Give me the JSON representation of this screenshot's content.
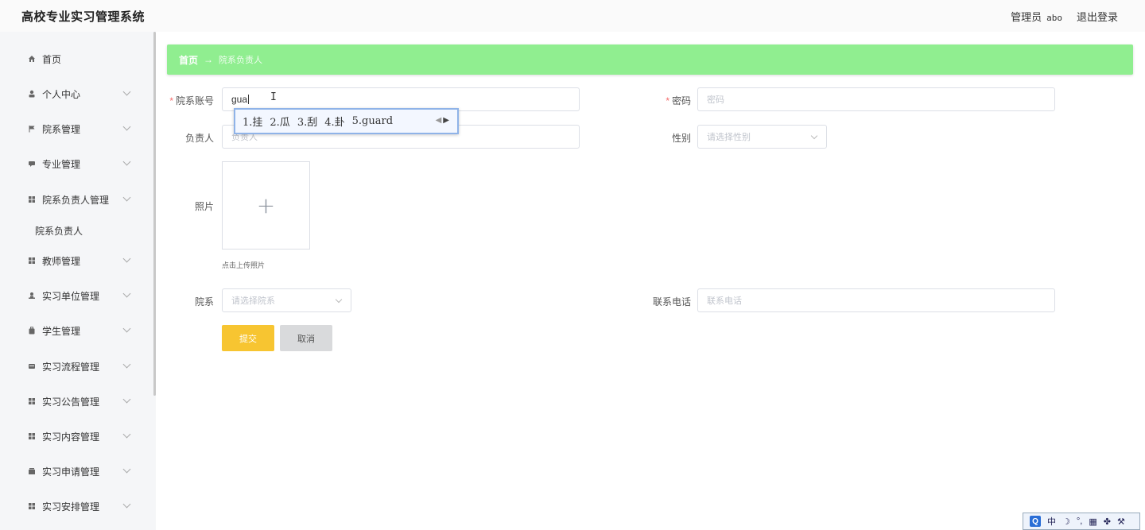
{
  "header": {
    "app_title": "高校专业实习管理系统",
    "role": "管理员",
    "username": "abo",
    "logout": "退出登录"
  },
  "sidebar": {
    "items": [
      {
        "label": "首页",
        "icon": "home-icon",
        "expandable": false
      },
      {
        "label": "个人中心",
        "icon": "user-icon",
        "expandable": true
      },
      {
        "label": "院系管理",
        "icon": "flag-icon",
        "expandable": true
      },
      {
        "label": "专业管理",
        "icon": "chat-icon",
        "expandable": true
      },
      {
        "label": "院系负责人管理",
        "icon": "grid-icon",
        "expandable": true,
        "expanded": true,
        "children": [
          "院系负责人"
        ]
      },
      {
        "label": "教师管理",
        "icon": "grid-icon",
        "expandable": true
      },
      {
        "label": "实习单位管理",
        "icon": "person-icon",
        "expandable": true
      },
      {
        "label": "学生管理",
        "icon": "bag-icon",
        "expandable": true
      },
      {
        "label": "实习流程管理",
        "icon": "card-icon",
        "expandable": true
      },
      {
        "label": "实习公告管理",
        "icon": "grid-icon",
        "expandable": true
      },
      {
        "label": "实习内容管理",
        "icon": "grid-icon",
        "expandable": true
      },
      {
        "label": "实习申请管理",
        "icon": "box-icon",
        "expandable": true
      },
      {
        "label": "实习安排管理",
        "icon": "grid-icon",
        "expandable": true
      }
    ]
  },
  "breadcrumb": {
    "home": "首页",
    "separator": "→",
    "current": "院系负责人"
  },
  "form": {
    "account_label": "院系账号",
    "account_value": "gua",
    "password_label": "密码",
    "password_placeholder": "密码",
    "manager_label": "负责人",
    "manager_placeholder": "负责人",
    "gender_label": "性别",
    "gender_placeholder": "请选择性别",
    "photo_label": "照片",
    "photo_tip": "点击上传照片",
    "department_label": "院系",
    "department_placeholder": "请选择院系",
    "phone_label": "联系电话",
    "phone_placeholder": "联系电话",
    "submit": "提交",
    "cancel": "取消"
  },
  "ime": {
    "candidates": [
      "1.挂",
      "2.瓜",
      "3.刮",
      "4.卦",
      "5.guard"
    ]
  },
  "tray": {
    "mode": "中"
  },
  "colors": {
    "breadcrumb_bg": "#90ee90",
    "submit_bg": "#f7c531",
    "cancel_bg": "#d9dadc",
    "required": "#f56c6c"
  }
}
